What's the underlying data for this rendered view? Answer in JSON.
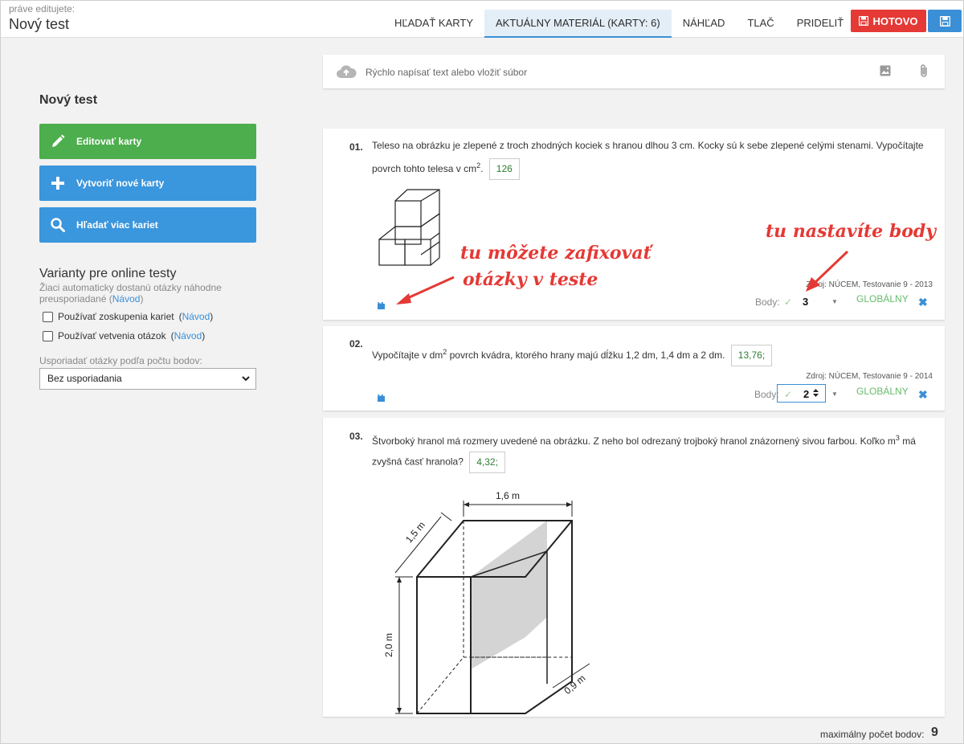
{
  "header": {
    "editing_label": "práve editujete:",
    "title": "Nový test",
    "tabs": [
      {
        "label": "HĽADAŤ KARTY"
      },
      {
        "label": "AKTUÁLNY MATERIÁL (KARTY: 6)",
        "active": true
      },
      {
        "label": "NÁHĽAD"
      },
      {
        "label": "TLAČ"
      },
      {
        "label": "PRIDELIŤ"
      }
    ],
    "done_label": "HOTOVO",
    "accent": "#3a8fd6",
    "done_color": "#e53935"
  },
  "sidebar": {
    "title": "Nový test",
    "buttons": [
      {
        "label": "Editovať karty",
        "icon": "pencil-icon",
        "color": "#4cae4c"
      },
      {
        "label": "Vytvoriť nové karty",
        "icon": "plus-icon",
        "color": "#3a96dd"
      },
      {
        "label": "Hľadať viac kariet",
        "icon": "search-icon",
        "color": "#3a96dd"
      }
    ],
    "variants_title": "Varianty pre online testy",
    "variants_desc": "Žiaci automaticky dostanú otázky náhodne preusporiadané",
    "navod": "Návod",
    "checkboxes": [
      {
        "label": "Používať zoskupenia kariet",
        "checked": false
      },
      {
        "label": "Používať vetvenia otázok",
        "checked": false
      }
    ],
    "sort_label": "Usporiadať otázky podľa počtu bodov:",
    "sort_value": "Bez usporiadania"
  },
  "quick_input": {
    "placeholder": "Rýchlo napísať text alebo vložiť súbor"
  },
  "questions": [
    {
      "num": "01.",
      "text_a": "Teleso na obrázku je zlepené z troch zhodných kociek s hranou dlhou 3 cm. Kocky sú k sebe zlepené celými stenami. Vypočítajte",
      "text_b": "povrch tohto telesa v cm",
      "sup": "2",
      "text_c": ".",
      "answer": "126",
      "source": "Zdroj: NÚCEM, Testovanie 9 - 2013",
      "points_label": "Body:",
      "points": "3",
      "scope": "GLOBÁLNY"
    },
    {
      "num": "02.",
      "text_a": "Vypočítajte v dm",
      "sup": "2",
      "text_b": " povrch kvádra, ktorého hrany majú dĺžku 1,2 dm, 1,4 dm a 2 dm.",
      "answer": "13,76;",
      "source": "Zdroj: NÚCEM, Testovanie 9 - 2014",
      "points_label": "Body:",
      "points": "2",
      "scope": "GLOBÁLNY"
    },
    {
      "num": "03.",
      "text_a": "Štvorboký hranol má rozmery uvedené na obrázku. Z neho bol odrezaný trojboký hranol znázornený sivou farbou. Koľko m",
      "sup": "3",
      "text_b": " má",
      "text_c": "zvyšná časť hranola?",
      "answer": "4,32;",
      "dims": {
        "top": "1,6 m",
        "side": "1,5 m",
        "height": "2,0 m",
        "depth": "0,9 m"
      }
    }
  ],
  "annotations": {
    "lock_hint_1": "tu môžete zafixovať",
    "lock_hint_2": "otázky v teste",
    "points_hint": "tu nastavíte body",
    "color": "#e53935"
  },
  "footer": {
    "max_label": "maximálny počet bodov:",
    "max_value": "9"
  }
}
